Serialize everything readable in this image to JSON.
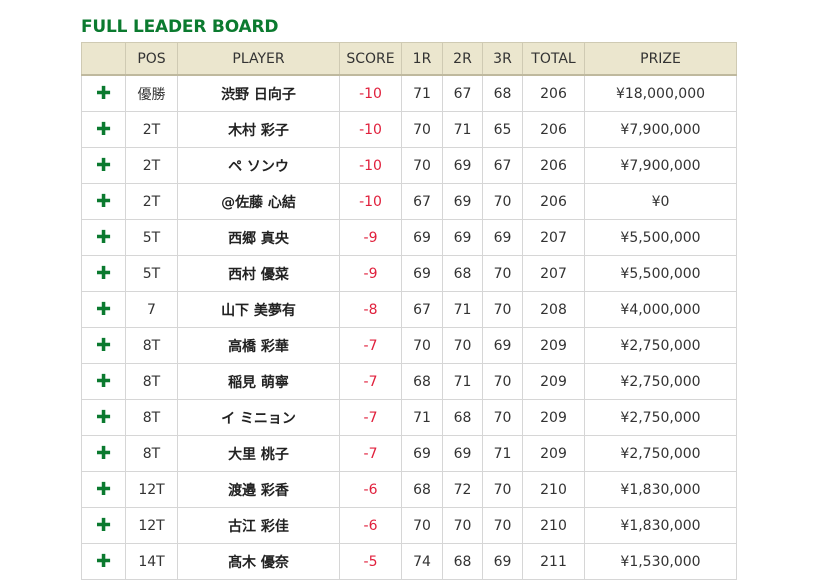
{
  "title": "FULL LEADER BOARD",
  "columns": {
    "pos": "POS",
    "player": "PLAYER",
    "score": "SCORE",
    "r1": "1R",
    "r2": "2R",
    "r3": "3R",
    "total": "TOTAL",
    "prize": "PRIZE"
  },
  "rows": [
    {
      "pos": "優勝",
      "player": "渋野 日向子",
      "score": "-10",
      "r1": "71",
      "r2": "67",
      "r3": "68",
      "total": "206",
      "prize": "¥18,000,000"
    },
    {
      "pos": "2T",
      "player": "木村 彩子",
      "score": "-10",
      "r1": "70",
      "r2": "71",
      "r3": "65",
      "total": "206",
      "prize": "¥7,900,000"
    },
    {
      "pos": "2T",
      "player": "ペ ソンウ",
      "score": "-10",
      "r1": "70",
      "r2": "69",
      "r3": "67",
      "total": "206",
      "prize": "¥7,900,000"
    },
    {
      "pos": "2T",
      "player": "@佐藤 心結",
      "score": "-10",
      "r1": "67",
      "r2": "69",
      "r3": "70",
      "total": "206",
      "prize": "¥0"
    },
    {
      "pos": "5T",
      "player": "西郷 真央",
      "score": "-9",
      "r1": "69",
      "r2": "69",
      "r3": "69",
      "total": "207",
      "prize": "¥5,500,000"
    },
    {
      "pos": "5T",
      "player": "西村 優菜",
      "score": "-9",
      "r1": "69",
      "r2": "68",
      "r3": "70",
      "total": "207",
      "prize": "¥5,500,000"
    },
    {
      "pos": "7",
      "player": "山下 美夢有",
      "score": "-8",
      "r1": "67",
      "r2": "71",
      "r3": "70",
      "total": "208",
      "prize": "¥4,000,000"
    },
    {
      "pos": "8T",
      "player": "高橋 彩華",
      "score": "-7",
      "r1": "70",
      "r2": "70",
      "r3": "69",
      "total": "209",
      "prize": "¥2,750,000"
    },
    {
      "pos": "8T",
      "player": "稲見 萌寧",
      "score": "-7",
      "r1": "68",
      "r2": "71",
      "r3": "70",
      "total": "209",
      "prize": "¥2,750,000"
    },
    {
      "pos": "8T",
      "player": "イ ミニョン",
      "score": "-7",
      "r1": "71",
      "r2": "68",
      "r3": "70",
      "total": "209",
      "prize": "¥2,750,000"
    },
    {
      "pos": "8T",
      "player": "大里 桃子",
      "score": "-7",
      "r1": "69",
      "r2": "69",
      "r3": "71",
      "total": "209",
      "prize": "¥2,750,000"
    },
    {
      "pos": "12T",
      "player": "渡邉 彩香",
      "score": "-6",
      "r1": "68",
      "r2": "72",
      "r3": "70",
      "total": "210",
      "prize": "¥1,830,000"
    },
    {
      "pos": "12T",
      "player": "古江 彩佳",
      "score": "-6",
      "r1": "70",
      "r2": "70",
      "r3": "70",
      "total": "210",
      "prize": "¥1,830,000"
    },
    {
      "pos": "14T",
      "player": "髙木 優奈",
      "score": "-5",
      "r1": "74",
      "r2": "68",
      "r3": "69",
      "total": "211",
      "prize": "¥1,530,000"
    }
  ],
  "icons": {
    "expand": "plus-icon",
    "color": "#0b7a2f"
  },
  "colors": {
    "title": "#0b7a2f",
    "score": "#e0203c",
    "header_bg": "#ebe6ce"
  }
}
